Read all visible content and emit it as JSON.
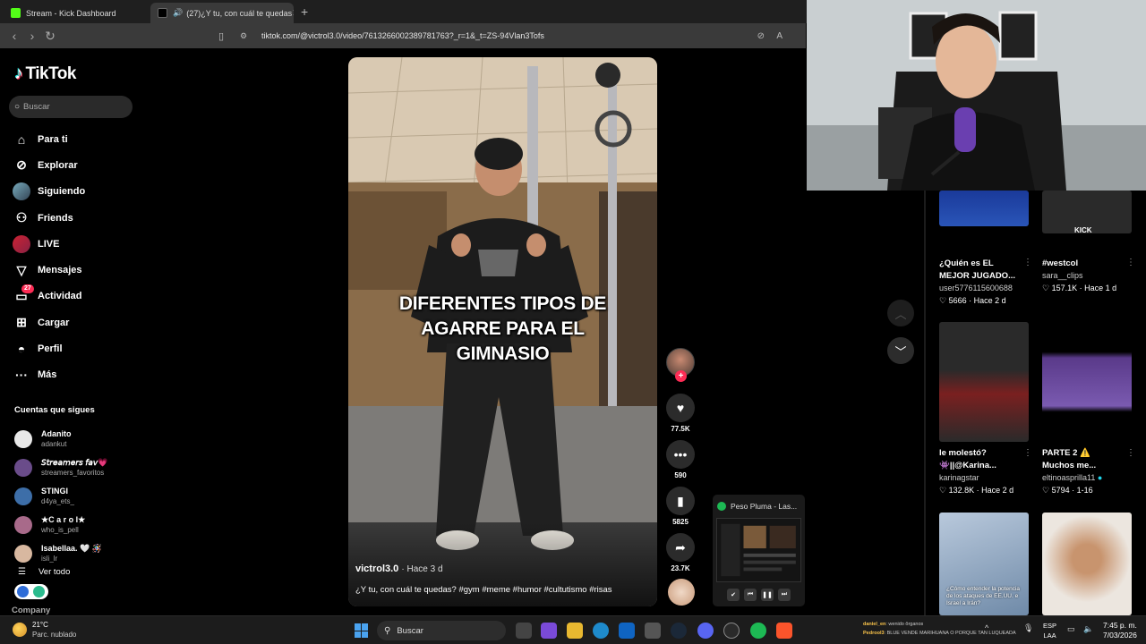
{
  "browser": {
    "tabs": [
      {
        "label": "Stream - Kick Dashboard",
        "active": false,
        "favicon_color": "#53fc18"
      },
      {
        "label": "(27)¿Y tu, con cuál te quedas",
        "active": true,
        "favicon_color": "#ffffff"
      }
    ],
    "new_tab_icon": "plus-icon",
    "url": "tiktok.com/@victrol3.0/video/7613266002389781763?_r=1&_t=ZS-94Vlan3Tofs"
  },
  "tiktok": {
    "brand": "TikTok",
    "search_placeholder": "Buscar",
    "nav": [
      {
        "label": "Para ti",
        "icon": "home-icon",
        "glyph": "⌂"
      },
      {
        "label": "Explorar",
        "icon": "compass-icon",
        "glyph": "⊘"
      },
      {
        "label": "Siguiendo",
        "icon": "avatar-icon",
        "glyph": ""
      },
      {
        "label": "Friends",
        "icon": "friends-icon",
        "glyph": "👥"
      },
      {
        "label": "LIVE",
        "icon": "live-icon",
        "glyph": ""
      },
      {
        "label": "Mensajes",
        "icon": "send-icon",
        "glyph": "▽"
      },
      {
        "label": "Actividad",
        "icon": "activity-icon",
        "glyph": "▭",
        "badge": "27"
      },
      {
        "label": "Cargar",
        "icon": "upload-icon",
        "glyph": "⊞"
      },
      {
        "label": "Perfil",
        "icon": "profile-icon",
        "glyph": "◓"
      },
      {
        "label": "Más",
        "icon": "more-icon",
        "glyph": "···"
      }
    ],
    "following_title": "Cuentas que sigues",
    "following": [
      {
        "name": "Adanito",
        "handle": "adankut",
        "color": "#e8e8e8"
      },
      {
        "name": "𝘚𝘵𝘳𝘦𝘢𝘮𝘦𝘳𝘴 𝘧𝘢𝘷💗",
        "handle": "streamers_favoritos",
        "color": "#6a4c8a"
      },
      {
        "name": "STINGI",
        "handle": "d4ya_ets_",
        "color": "#3d6ea8"
      },
      {
        "name": "★C a r o l★",
        "handle": "who_is_pell",
        "color": "#a86a8a"
      },
      {
        "name": "Isabellaa. 🤍 🪅",
        "handle": "isli_lr",
        "color": "#d8b8a0"
      }
    ],
    "see_all": "Ver todo",
    "company": "Company"
  },
  "video": {
    "caption_lines": [
      "DIFERENTES TIPOS DE",
      "AGARRE PARA EL",
      "GIMNASIO"
    ],
    "author": "victrol3.0",
    "posted": "· Hace 3 d",
    "description": "¿Y tu, con cuál te quedas? #gym #meme #humor #cultutismo #risas",
    "likes": "77.5K",
    "comments": "590",
    "saves": "5825",
    "shares": "23.7K"
  },
  "mini_player": {
    "title": "Peso Pluma - Las...",
    "controls": [
      "check-icon",
      "previous-icon",
      "pause-icon",
      "next-icon"
    ]
  },
  "recommendations": [
    {
      "title": "",
      "user": "",
      "meta": "",
      "thumb_color": "#2a55b8"
    },
    {
      "title": "",
      "user": "",
      "meta": "",
      "overlay": "KICK",
      "thumb_color": "#2a2a2a"
    },
    {
      "title": "¿Quién es EL MEJOR JUGADO...",
      "user": "user5776115600688",
      "likes": "5666",
      "age": "Hace 2 d"
    },
    {
      "title": "#westcol",
      "user": "sara__clips",
      "likes": "157.1K",
      "age": "Hace 1 d"
    },
    {
      "title": "le molestó? 👾||@Karina...",
      "user": "karinagstar",
      "likes": "132.8K",
      "age": "Hace 2 d",
      "thumb_color": "#3a2020"
    },
    {
      "title": "PARTE 2 ⚠️ Muchos me...",
      "user": "eltinoasprilla11",
      "likes": "5794",
      "age": "1-16",
      "thumb_color": "#4a3a6a"
    },
    {
      "title": "",
      "user": "",
      "thumb_text": "¿Cómo entender la potencia de los ataques de EE.UU. e Israel a Irán?",
      "thumb_color": "#8fa6c4"
    },
    {
      "title": "",
      "user": "",
      "thumb_color": "#c8a890"
    }
  ],
  "taskbar": {
    "temperature": "21°C",
    "weather": "Parc. nublado",
    "search_placeholder": "Buscar",
    "chat_line1_user": "daniel_en",
    "chat_line1": ": wenido ōrganos",
    "chat_line2_user": "Pedrool3",
    "chat_line2": ": BLUE VENDE MARIHUANA O PORQUE TAN LUQUEADA",
    "lang": "ESP",
    "lang_sub": "LAA",
    "time": "7:45 p. m.",
    "date": "7/03/2026"
  }
}
